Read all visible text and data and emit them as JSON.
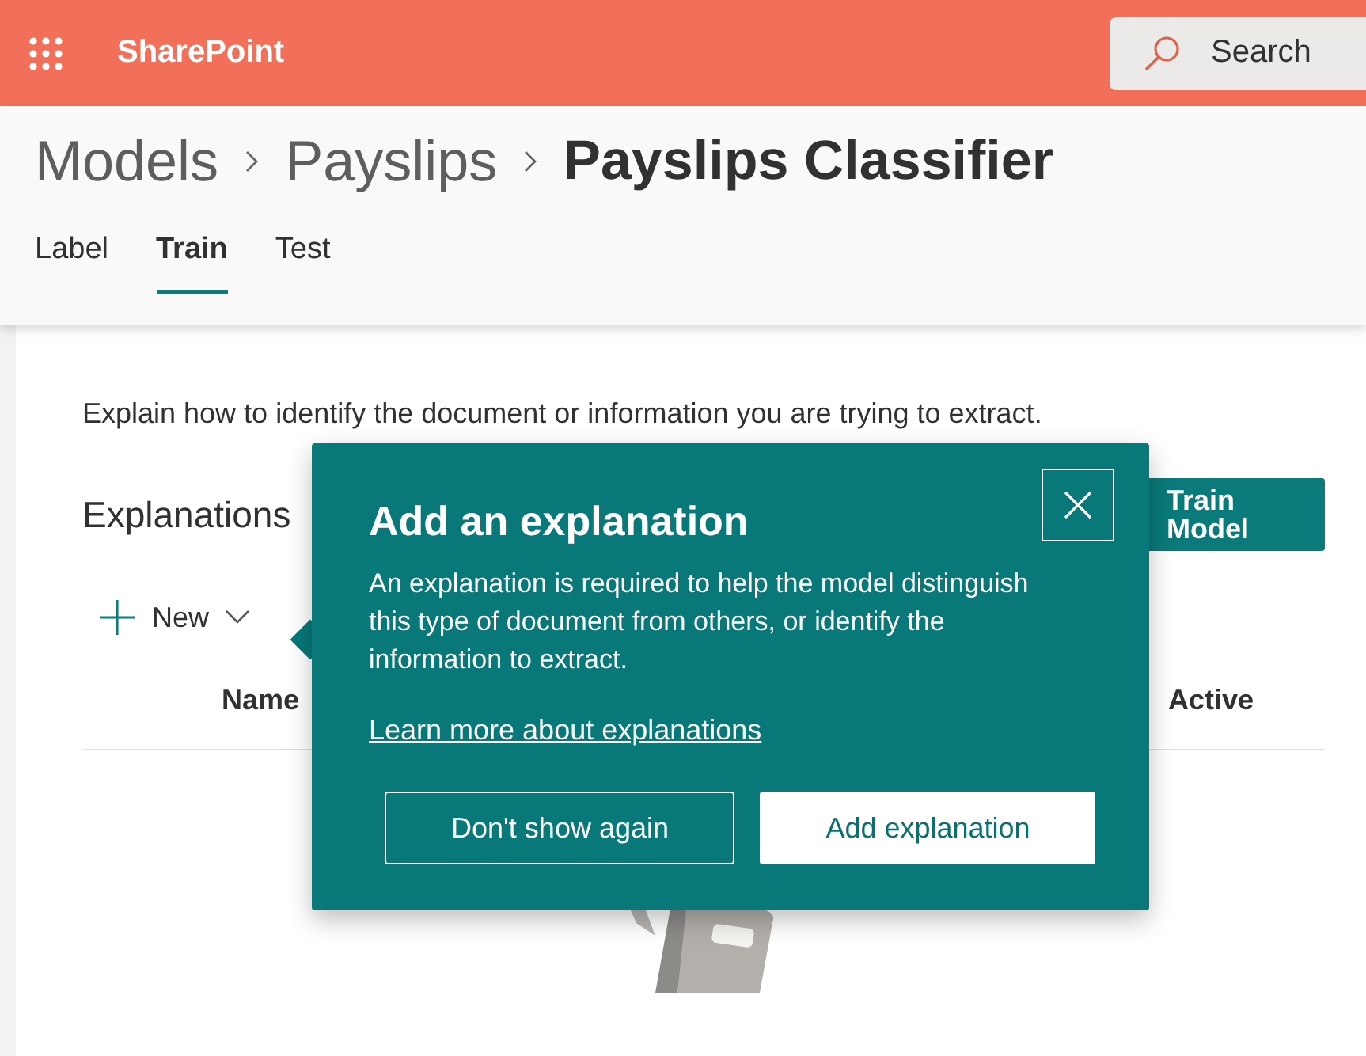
{
  "app_bar": {
    "app_name": "SharePoint",
    "search": {
      "placeholder": "Search"
    }
  },
  "breadcrumb": [
    {
      "label": "Models",
      "current": false
    },
    {
      "label": "Payslips",
      "current": false
    },
    {
      "label": "Payslips Classifier",
      "current": true
    }
  ],
  "tabs": [
    {
      "label": "Label",
      "selected": false
    },
    {
      "label": "Train",
      "selected": true
    },
    {
      "label": "Test",
      "selected": false
    }
  ],
  "intro": "Explain how to identify the document or information you are trying to extract.",
  "section_title": "Explanations",
  "train_button": "Train Model",
  "new_button": "New",
  "columns": [
    "Name",
    "Active"
  ],
  "popup": {
    "title": "Add an explanation",
    "body": "An explanation is required to help the model distinguish this type of document from others, or identify the information to extract.",
    "link": "Learn more about explanations",
    "secondary": "Don't show again",
    "primary": "Add explanation"
  }
}
